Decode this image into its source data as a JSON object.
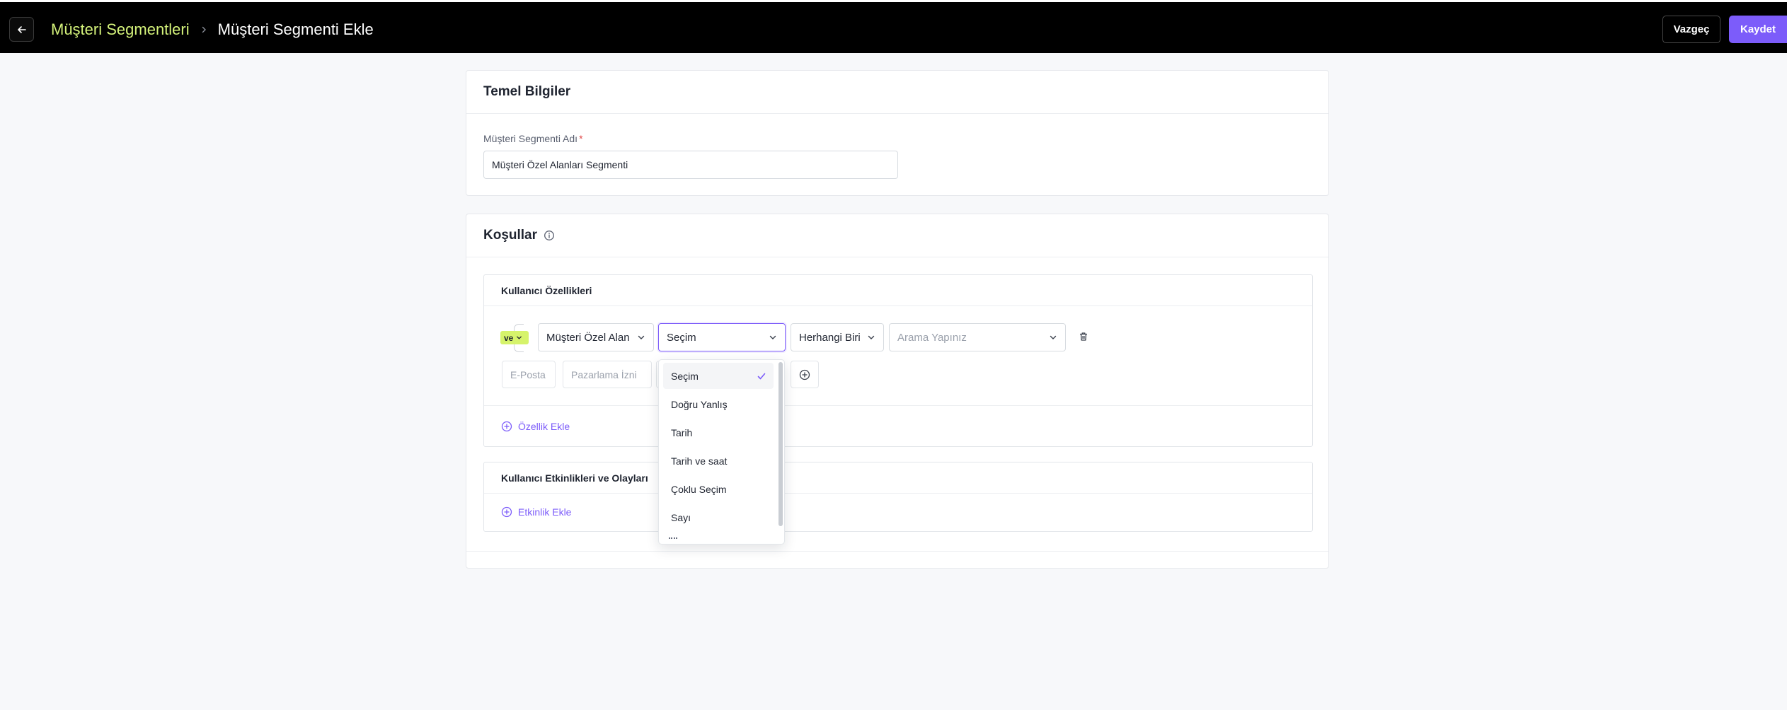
{
  "header": {
    "breadcrumb_parent": "Müşteri Segmentleri",
    "breadcrumb_current": "Müşteri Segmenti Ekle",
    "cancel_label": "Vazgeç",
    "save_label": "Kaydet",
    "accent_color": "#d4f27a",
    "primary_color": "#7c5cfa"
  },
  "basic_info": {
    "title": "Temel Bilgiler",
    "name_label": "Müşteri Segmenti Adı",
    "required_mark": "*",
    "name_value": "Müşteri Özel Alanları Segmenti"
  },
  "conditions": {
    "title": "Koşullar",
    "user_properties": {
      "title": "Kullanıcı Özellikleri",
      "logic_operator": "ve",
      "row": {
        "field": "Müşteri Özel Alan",
        "type": "Seçim",
        "operator": "Herhangi Biri",
        "search_placeholder": "Arama Yapınız"
      },
      "tags": [
        "E-Posta",
        "Pazarlama İzni"
      ],
      "add_label": "Özellik Ekle"
    },
    "user_events": {
      "title": "Kullanıcı Etkinlikleri ve Olayları",
      "add_label": "Etkinlik Ekle"
    }
  },
  "type_dropdown": {
    "selected": "Seçim",
    "options": [
      "Seçim",
      "Doğru Yanlış",
      "Tarih",
      "Tarih ve saat",
      "Çoklu Seçim",
      "Sayı"
    ]
  }
}
